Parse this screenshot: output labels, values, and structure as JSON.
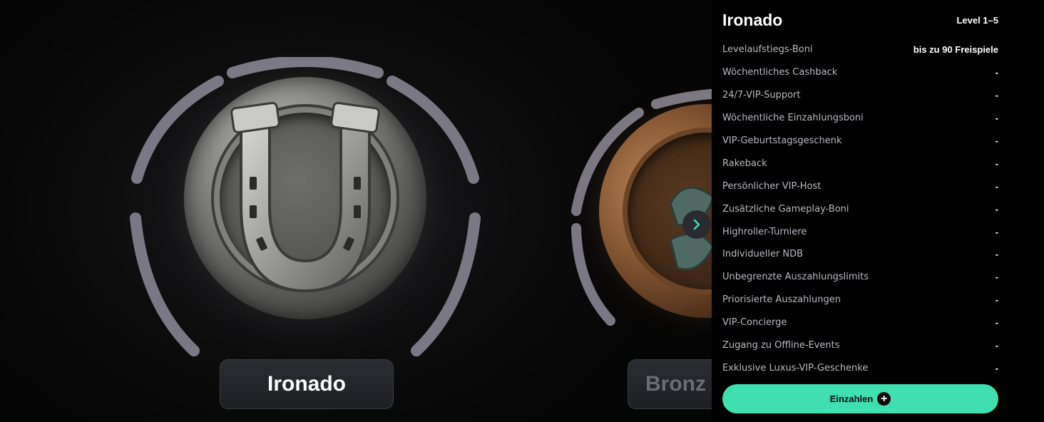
{
  "tiers": {
    "current_name": "Ironado",
    "next_name_visible": "Bronz"
  },
  "panel": {
    "title": "Ironado",
    "level": "Level 1–5",
    "benefits": [
      {
        "label": "Levelaufstiegs-Boni",
        "value": "bis zu 90 Freispiele"
      },
      {
        "label": "Wöchentliches Cashback",
        "value": "-"
      },
      {
        "label": "24/7-VIP-Support",
        "value": "-"
      },
      {
        "label": "Wöchentliche Einzahlungsboni",
        "value": "-"
      },
      {
        "label": "VIP-Geburtstagsgeschenk",
        "value": "-"
      },
      {
        "label": "Rakeback",
        "value": "-"
      },
      {
        "label": "Persönlicher VIP-Host",
        "value": "-"
      },
      {
        "label": "Zusätzliche Gameplay-Boni",
        "value": "-"
      },
      {
        "label": "Highroller-Turniere",
        "value": "-"
      },
      {
        "label": "Individueller NDB",
        "value": "-"
      },
      {
        "label": "Unbegrenzte Auszahlungslimits",
        "value": "-"
      },
      {
        "label": "Priorisierte Auszahlungen",
        "value": "-"
      },
      {
        "label": "VIP-Concierge",
        "value": "-"
      },
      {
        "label": "Zugang zu Offline-Events",
        "value": "-"
      },
      {
        "label": "Exklusive Luxus-VIP-Geschenke",
        "value": "-"
      }
    ],
    "deposit_label": "Einzahlen"
  },
  "icons": {
    "next": "chevron-right-icon",
    "deposit": "plus-circle-icon"
  },
  "colors": {
    "accent": "#3fdfb0",
    "ring": "#7a7884",
    "background": "#050505"
  }
}
